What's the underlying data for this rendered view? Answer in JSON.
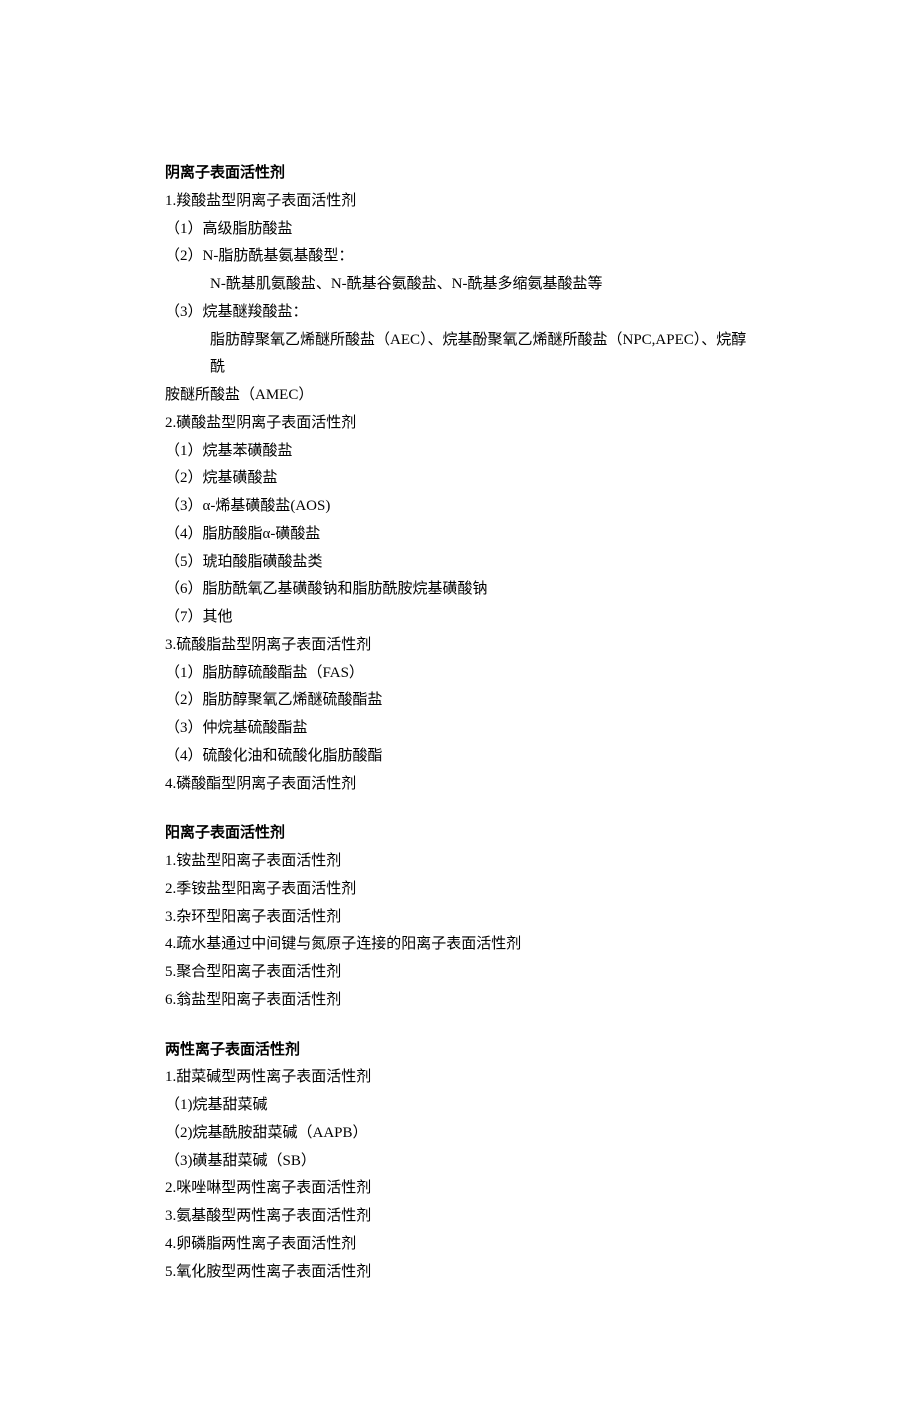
{
  "sections": [
    {
      "heading": "阴离子表面活性剂",
      "lines": [
        "1.羧酸盐型阴离子表面活性剂",
        "（1）高级脂肪酸盐",
        "（2）N-脂肪酰基氨基酸型：",
        {
          "text": "N-酰基肌氨酸盐、N-酰基谷氨酸盐、N-酰基多缩氨基酸盐等",
          "indent": true
        },
        "（3）烷基醚羧酸盐：",
        {
          "text": "脂肪醇聚氧乙烯醚所酸盐（AEC）、烷基酚聚氧乙烯醚所酸盐（NPC,APEC）、烷醇酰",
          "indent": true
        },
        "胺醚所酸盐（AMEC）",
        "2.磺酸盐型阴离子表面活性剂",
        "（1）烷基苯磺酸盐",
        "（2）烷基磺酸盐",
        "（3）α-烯基磺酸盐(AOS)",
        "（4）脂肪酸脂α-磺酸盐",
        "（5）琥珀酸脂磺酸盐类",
        "（6）脂肪酰氧乙基磺酸钠和脂肪酰胺烷基磺酸钠",
        "（7）其他",
        "3.硫酸脂盐型阴离子表面活性剂",
        "（1）脂肪醇硫酸酯盐（FAS）",
        "（2）脂肪醇聚氧乙烯醚硫酸酯盐",
        "（3）仲烷基硫酸酯盐",
        "（4）硫酸化油和硫酸化脂肪酸酯",
        "4.磷酸酯型阴离子表面活性剂"
      ]
    },
    {
      "heading": "阳离子表面活性剂",
      "lines": [
        "1.铵盐型阳离子表面活性剂",
        "2.季铵盐型阳离子表面活性剂",
        "3.杂环型阳离子表面活性剂",
        "4.疏水基通过中间键与氮原子连接的阳离子表面活性剂",
        "5.聚合型阳离子表面活性剂",
        "6.翁盐型阳离子表面活性剂"
      ]
    },
    {
      "heading": "两性离子表面活性剂",
      "lines": [
        "1.甜菜碱型两性离子表面活性剂",
        "（1)烷基甜菜碱",
        "（2)烷基酰胺甜菜碱（AAPB）",
        "（3)磺基甜菜碱（SB）",
        "2.咪唑啉型两性离子表面活性剂",
        "3.氨基酸型两性离子表面活性剂",
        "4.卵磷脂两性离子表面活性剂",
        "5.氧化胺型两性离子表面活性剂"
      ]
    }
  ]
}
